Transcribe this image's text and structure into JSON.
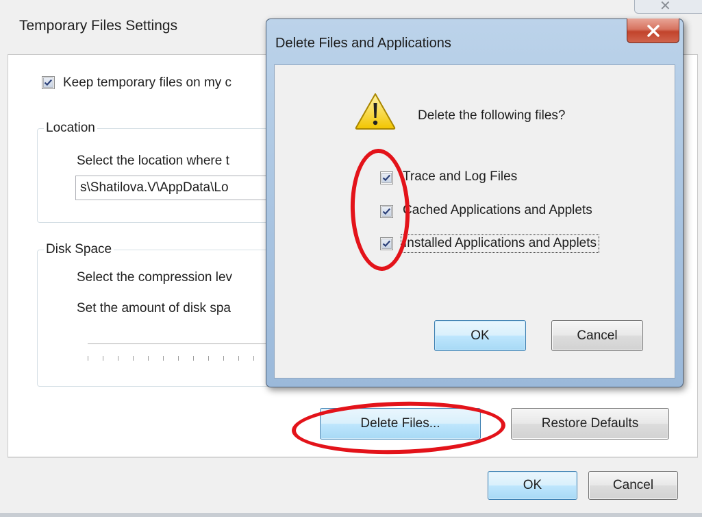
{
  "background_window": {
    "title": "Temporary Files Settings",
    "keep_checkbox": {
      "label": "Keep temporary files on my c",
      "checked": true
    },
    "location": {
      "legend": "Location",
      "description": "Select the location where t",
      "path": "s\\Shatilova.V\\AppData\\Lo"
    },
    "disk_space": {
      "legend": "Disk Space",
      "compression_label": "Select the compression lev",
      "amount_label": "Set the amount of disk spa"
    },
    "delete_files_label": "Delete Files...",
    "restore_defaults_label": "Restore Defaults",
    "ok_label": "OK",
    "cancel_label": "Cancel"
  },
  "dialog": {
    "title": "Delete Files and Applications",
    "question": "Delete the following files?",
    "items": [
      {
        "label": "Trace and Log Files",
        "checked": true
      },
      {
        "label": "Cached Applications and Applets",
        "checked": true
      },
      {
        "label": "Installed Applications and Applets",
        "checked": true
      }
    ],
    "ok_label": "OK",
    "cancel_label": "Cancel"
  },
  "colors": {
    "annotation": "#e3131a",
    "focus_button": "#3c7fb1",
    "close_button": "#c2432b"
  },
  "icons": {
    "warning": "warning-icon",
    "close": "close-icon",
    "check": "checkmark-icon"
  }
}
